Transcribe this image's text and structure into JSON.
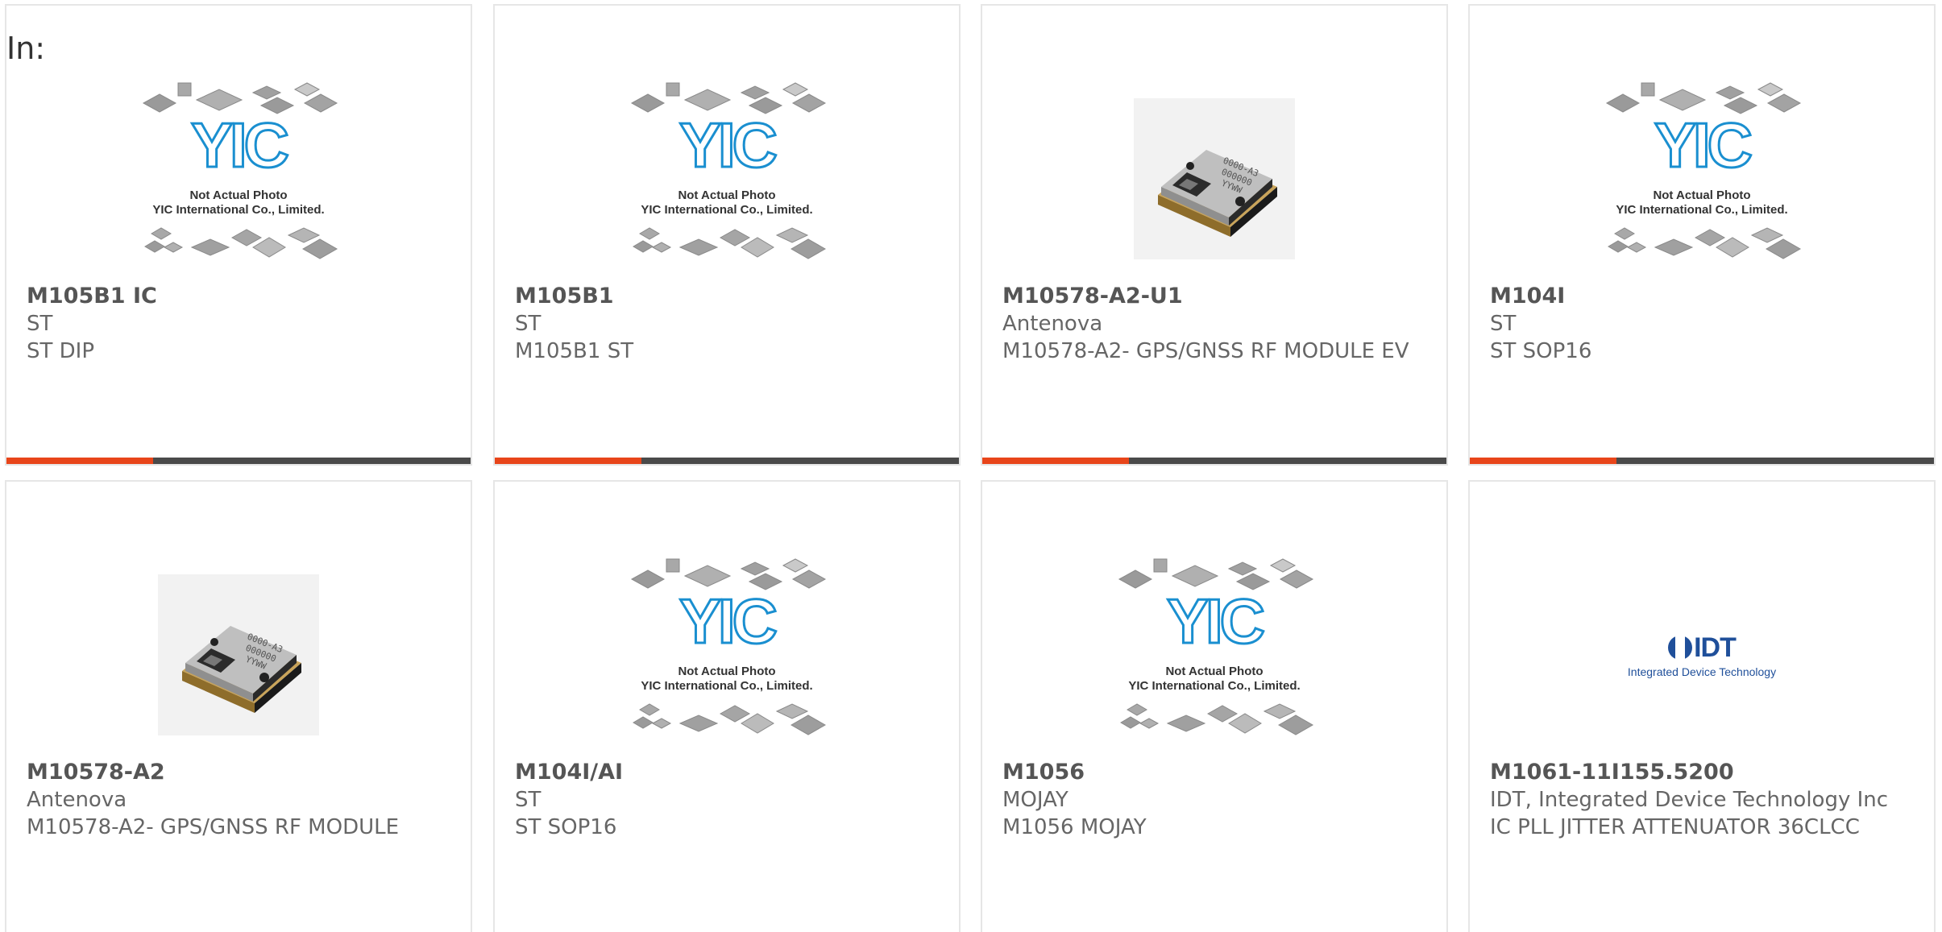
{
  "header": {
    "in_label": "In:"
  },
  "placeholder": {
    "brand": "YIC",
    "line1": "Not Actual Photo",
    "line2": "YIC International Co., Limited."
  },
  "products": [
    {
      "part": "M105B1 IC",
      "mfr": "ST",
      "desc": "ST DIP",
      "image": "placeholder"
    },
    {
      "part": "M105B1",
      "mfr": "ST",
      "desc": "M105B1 ST",
      "image": "placeholder"
    },
    {
      "part": "M10578-A2-U1",
      "mfr": "Antenova",
      "desc": "M10578-A2- GPS/GNSS RF MODULE EV",
      "image": "module"
    },
    {
      "part": "M104I",
      "mfr": "ST",
      "desc": "ST SOP16",
      "image": "placeholder"
    },
    {
      "part": "M10578-A2",
      "mfr": "Antenova",
      "desc": "M10578-A2- GPS/GNSS RF MODULE",
      "image": "module"
    },
    {
      "part": "M104I/AI",
      "mfr": "ST",
      "desc": "ST SOP16",
      "image": "placeholder"
    },
    {
      "part": "M1056",
      "mfr": "MOJAY",
      "desc": "M1056 MOJAY",
      "image": "placeholder"
    },
    {
      "part": "M1061-11I155.5200",
      "mfr": "IDT, Integrated Device Technology Inc",
      "desc": "IC PLL JITTER ATTENUATOR 36CLCC",
      "image": "idt-logo"
    }
  ],
  "module_label": [
    "0000-A3",
    "000000",
    "YYWW"
  ],
  "idt": {
    "logo_text": "IDT",
    "logo_sub": "Integrated Device Technology"
  },
  "colors": {
    "accent": "#e8451a",
    "bar": "#4a4a4a",
    "brand_blue": "#1a8fd0",
    "idt_blue": "#1f4f9a"
  }
}
